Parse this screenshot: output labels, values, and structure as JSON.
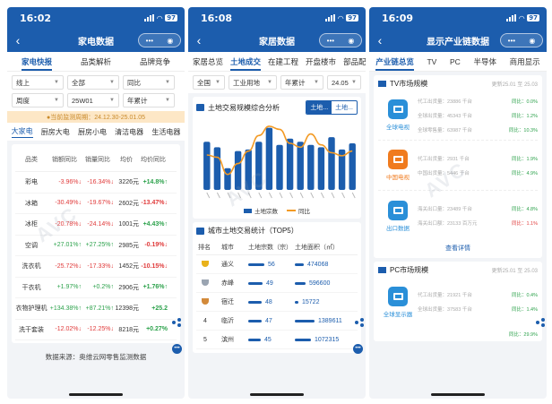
{
  "screens": [
    {
      "time": "16:02",
      "battery": "97",
      "title": "家电数据",
      "tabs": [
        "家电快报",
        "品类解析",
        "品牌竞争"
      ],
      "filters": [
        {
          "value": "线上"
        },
        {
          "value": "全部"
        },
        {
          "value": "同比"
        },
        {
          "value": "周度"
        },
        {
          "value": "25W01"
        },
        {
          "value": "年累计"
        }
      ],
      "notice": "●当前监测周期：24.12.30-25.01.05",
      "categories": [
        "大家电",
        "厨房大电",
        "厨房小电",
        "清洁电器",
        "生活电器"
      ],
      "table_headers": [
        "品类",
        "销额同比",
        "销量同比",
        "均价",
        "均价同比"
      ],
      "rows": [
        {
          "name": "彩电",
          "sales": "-3.96%↓",
          "volume": "-16.34%↓",
          "price": "3226元",
          "price_yoy": "+14.8%↑"
        },
        {
          "name": "冰箱",
          "sales": "-30.49%↓",
          "volume": "-19.67%↓",
          "price": "2602元",
          "price_yoy": "-13.47%↓"
        },
        {
          "name": "冰柜",
          "sales": "-20.78%↓",
          "volume": "-24.14%↓",
          "price": "1001元",
          "price_yoy": "+4.43%↑"
        },
        {
          "name": "空调",
          "sales": "+27.01%↑",
          "volume": "+27.25%↑",
          "price": "2985元",
          "price_yoy": "-0.19%↓"
        },
        {
          "name": "洗衣机",
          "sales": "-25.72%↓",
          "volume": "-17.33%↓",
          "price": "1452元",
          "price_yoy": "-10.15%↓"
        },
        {
          "name": "干衣机",
          "sales": "+1.97%↑",
          "volume": "+0.2%↑",
          "price": "2906元",
          "price_yoy": "+1.76%↑"
        },
        {
          "name": "衣物护理机",
          "sales": "+134.38%↑",
          "volume": "+87.21%↑",
          "price": "12398元",
          "price_yoy": "+25.2"
        },
        {
          "name": "洗干套装",
          "sales": "-12.02%↓",
          "volume": "-12.25%↓",
          "price": "8218元",
          "price_yoy": "+0.27%"
        }
      ],
      "footer": "数据来源：奥维云网零售监测数据"
    },
    {
      "time": "16:08",
      "battery": "97",
      "title": "家居数据",
      "tabs": [
        "家居总览",
        "土地成交",
        "在建工程",
        "开盘楼市",
        "部品配套"
      ],
      "filters": [
        {
          "value": "全国"
        },
        {
          "value": "工业用地"
        },
        {
          "value": "年累计"
        },
        {
          "value": "24.05"
        }
      ],
      "chart_title": "土地交易规模综合分析",
      "segments": [
        "土地...",
        "土地..."
      ],
      "legend": [
        "土地宗数",
        "同比"
      ],
      "rank_title": "城市土地交易统计（TOP5）",
      "rank_headers": [
        "排名",
        "城市",
        "土地宗数（宗）",
        "土地面积（㎡）"
      ],
      "ranks": [
        {
          "rank": "",
          "city": "通义",
          "count": "56",
          "area": "474068"
        },
        {
          "rank": "",
          "city": "赤峰",
          "count": "49",
          "area": "596600"
        },
        {
          "rank": "",
          "city": "宿迁",
          "count": "48",
          "area": "15722"
        },
        {
          "rank": "4",
          "city": "临沂",
          "count": "47",
          "area": "1389611"
        },
        {
          "rank": "5",
          "city": "滨州",
          "count": "45",
          "area": "1072315"
        }
      ]
    },
    {
      "time": "16:09",
      "battery": "97",
      "title": "显示产业链数据",
      "tabs": [
        "产业链总览",
        "TV",
        "PC",
        "半导体",
        "商用显示"
      ],
      "tv_card": {
        "title": "TV市场规模",
        "date": "更新25.01 至 25.03",
        "items": [
          {
            "label": "全球电视",
            "lines": [
              "代工出货量：23886 千台",
              "全球出货量：45343 千台",
              "全球零售量：63987 千台"
            ],
            "yoy": [
              "同比：0.0%",
              "同比：1.2%",
              "同比：10.3%"
            ],
            "color": "#2a8fd8",
            "icon": "tv-icon"
          },
          {
            "label": "中国电视",
            "lines": [
              "代工出货量：2931 千台",
              "中国出货量：5446 千台"
            ],
            "yoy": [
              "同比：1.9%",
              "同比：4.9%"
            ],
            "color": "#f07b1e",
            "icon": "tv-icon"
          },
          {
            "label": "出口数据",
            "lines": [
              "海关出口量：23489 千台",
              "海关出口额：23133 百万元"
            ],
            "yoy": [
              "同比：4.8%",
              "同比：1.1%"
            ],
            "color": "#2a8fd8",
            "icon": "ship-icon"
          }
        ],
        "more": "查看详情"
      },
      "pc_card": {
        "title": "PC市场规模",
        "date": "更新25.01 至 25.03",
        "items": [
          {
            "label": "全球显示器",
            "lines": [
              "代工出货量：21921 千台",
              "全球出货量：37583 千台"
            ],
            "yoy": [
              "同比：0.4%",
              "同比：1.4%"
            ],
            "color": "#2a8fd8",
            "icon": "monitor-icon"
          }
        ],
        "extra": "同比：29.9%"
      }
    }
  ],
  "chart_data": {
    "type": "bar",
    "title": "土地交易规模综合分析",
    "categories": [
      "",
      "",
      "",
      "",
      "",
      "",
      "",
      "",
      "",
      "",
      "",
      "",
      "",
      "",
      ""
    ],
    "series": [
      {
        "name": "土地宗数",
        "values": [
          62,
          55,
          28,
          50,
          52,
          62,
          80,
          58,
          66,
          62,
          58,
          55,
          68,
          52,
          60
        ]
      },
      {
        "name": "同比",
        "values": [
          45,
          42,
          20,
          34,
          50,
          70,
          82,
          78,
          60,
          55,
          72,
          58,
          48,
          44,
          50
        ]
      }
    ],
    "legend_position": "bottom",
    "accent": "#1c5dad",
    "line_color": "#f39a24"
  }
}
